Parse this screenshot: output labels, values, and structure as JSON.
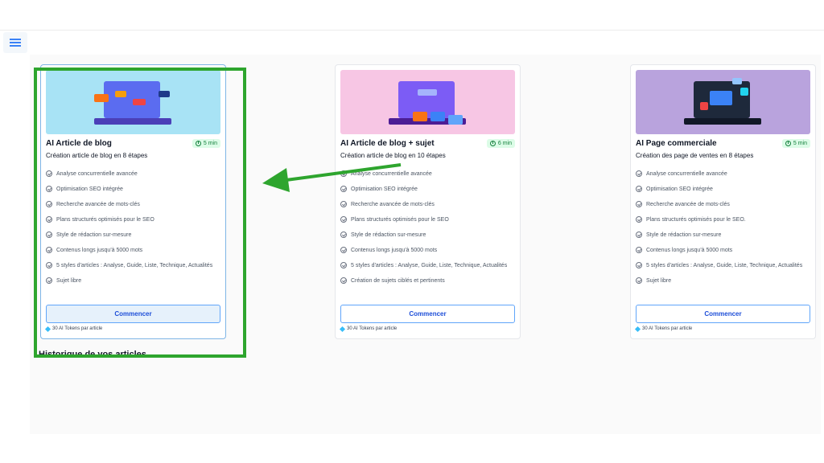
{
  "cards": [
    {
      "title": "AI Article de blog",
      "duration": "5 min",
      "subtitle": "Création article de blog en 8 étapes",
      "features": [
        "Analyse concurrentielle avancée",
        "Optimisation SEO intégrée",
        "Recherche avancée de mots-clés",
        "Plans structurés optimisés pour le SEO",
        "Style de rédaction sur-mesure",
        "Contenus longs jusqu'à 5000 mots",
        "5 styles d'articles : Analyse, Guide, Liste, Technique, Actualités",
        "Sujet libre"
      ],
      "button": "Commencer",
      "tokens": "30 AI Tokens par article",
      "thumb_color": "#a8e3f5"
    },
    {
      "title": "AI Article de blog + sujet",
      "duration": "6 min",
      "subtitle": "Création article de blog en 10 étapes",
      "features": [
        "Analyse concurrentielle avancée",
        "Optimisation SEO intégrée",
        "Recherche avancée de mots-clés",
        "Plans structurés optimisés pour le SEO",
        "Style de rédaction sur-mesure",
        "Contenus longs jusqu'à 5000 mots",
        "5 styles d'articles : Analyse, Guide, Liste, Technique, Actualités",
        "Création de sujets ciblés et pertinents"
      ],
      "button": "Commencer",
      "tokens": "30 AI Tokens par article",
      "thumb_color": "#f7c6e4"
    },
    {
      "title": "AI Page commerciale",
      "duration": "5 min",
      "subtitle": "Création des page de ventes en 8 étapes",
      "features": [
        "Analyse concurrentielle avancée",
        "Optimisation SEO intégrée",
        "Recherche avancée de mots-clés",
        "Plans structurés optimisés pour le SEO.",
        "Style de rédaction sur-mesure",
        "Contenus longs jusqu'à 5000 mots",
        "5 styles d'articles : Analyse, Guide, Liste, Technique, Actualités",
        "Sujet libre"
      ],
      "button": "Commencer",
      "tokens": "30 AI Tokens par article",
      "thumb_color": "#b9a3dd"
    }
  ],
  "history_title": "Historique de vos articles",
  "annotation_color": "#2ea52e"
}
